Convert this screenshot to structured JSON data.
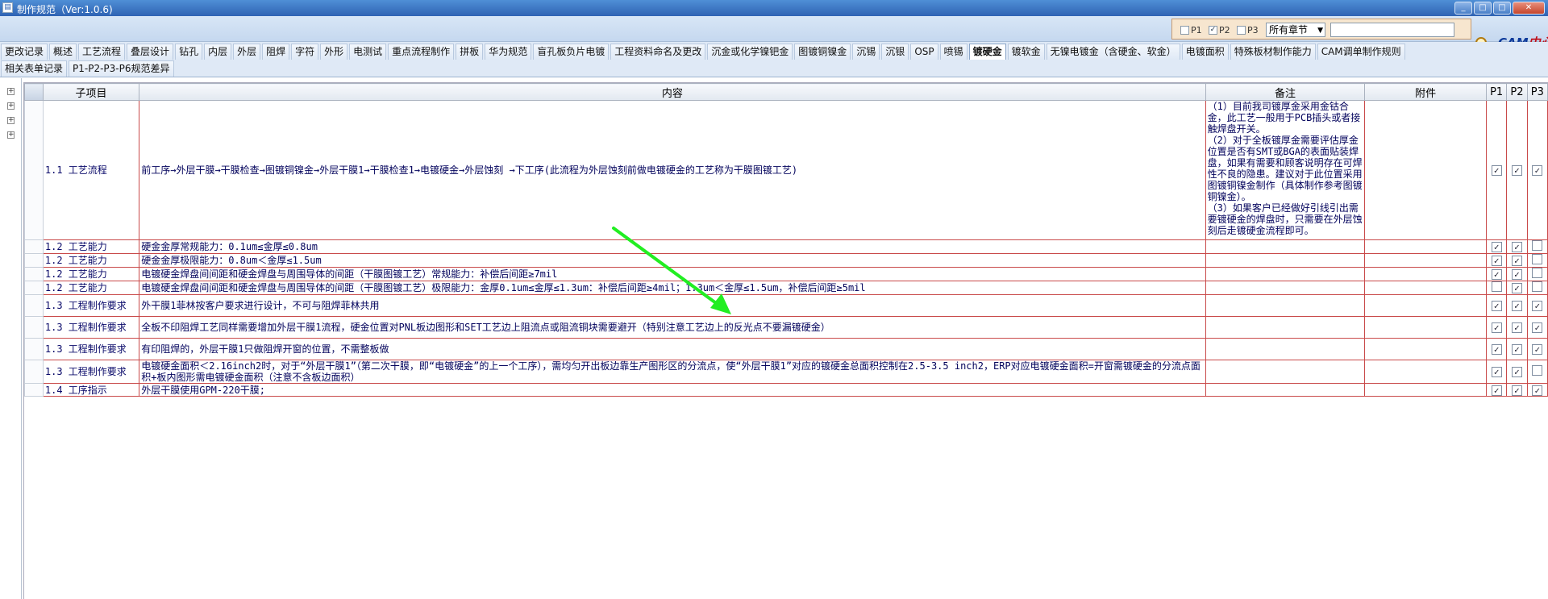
{
  "window": {
    "title": "制作规范（Ver:1.0.6)",
    "buttons": [
      "_",
      "□",
      "□",
      "✕"
    ]
  },
  "filter": {
    "p1": {
      "label": "P1",
      "checked": false
    },
    "p2": {
      "label": "P2",
      "checked": true
    },
    "p3": {
      "label": "P3",
      "checked": false
    },
    "chapter_select": "所有章节",
    "search_placeholder": ""
  },
  "logo": {
    "cam": "CAM",
    "rest": "中心"
  },
  "tabs_row1": [
    "更改记录",
    "概述",
    "工艺流程",
    "叠层设计",
    "钻孔",
    "内层",
    "外层",
    "阻焊",
    "字符",
    "外形",
    "电测试",
    "重点流程制作",
    "拼板",
    "华为规范",
    "盲孔板负片电镀",
    "工程资料命名及更改",
    "沉金或化学镍钯金",
    "图镀铜镍金",
    "沉锡",
    "沉银",
    "OSP",
    "喷锡",
    "镀硬金",
    "镀软金",
    "无镍电镀金（含硬金、软金）",
    "电镀面积",
    "特殊板材制作能力",
    "CAM调单制作规则"
  ],
  "tabs_row2": [
    "相关表单记录",
    "P1-P2-P3-P6规范差异"
  ],
  "active_tab": "镀硬金",
  "grid": {
    "headers": {
      "sub": "子项目",
      "content": "内容",
      "note": "备注",
      "attach": "附件",
      "p1": "P1",
      "p2": "P2",
      "p3": "P3"
    },
    "rows": [
      {
        "sub": "1.1 工艺流程",
        "content": "前工序→外层干膜→干膜检查→图镀铜镍金→外层干膜1→干膜检查1→电镀硬金→外层蚀刻 →下工序(此流程为外层蚀刻前做电镀硬金的工艺称为干膜图镀工艺)",
        "note": "（1）目前我司镀厚金采用金钴合金，此工艺一般用于PCB插头或者接触焊盘开关。\n（2）对于全板镀厚金需要评估厚金位置是否有SMT或BGA的表面贴装焊盘，如果有需要和顾客说明存在可焊性不良的隐患。建议对于此位置采用图镀铜镍金制作（具体制作参考图镀铜镍金）。\n（3）如果客户已经做好引线引出需要镀硬金的焊盘时，只需要在外层蚀刻后走镀硬金流程即可。",
        "attach": "",
        "p1": "✓",
        "p2": "✓",
        "p3": "✓"
      },
      {
        "sub": "1.2 工艺能力",
        "content": "硬金金厚常规能力：0.1um≤金厚≤0.8um",
        "note": "",
        "attach": "",
        "p1": "✓",
        "p2": "✓",
        "p3": ""
      },
      {
        "sub": "1.2 工艺能力",
        "content": "硬金金厚极限能力：0.8um＜金厚≤1.5um",
        "note": "",
        "attach": "",
        "p1": "✓",
        "p2": "✓",
        "p3": ""
      },
      {
        "sub": "1.2 工艺能力",
        "content": "电镀硬金焊盘间间距和硬金焊盘与周围导体的间距（干膜图镀工艺）常规能力：补偿后间距≥7mil",
        "note": "",
        "attach": "",
        "p1": "✓",
        "p2": "✓",
        "p3": ""
      },
      {
        "sub": "1.2 工艺能力",
        "content": "电镀硬金焊盘间间距和硬金焊盘与周围导体的间距（干膜图镀工艺）极限能力：金厚0.1um≤金厚≤1.3um：补偿后间距≥4mil；1.3um＜金厚≤1.5um，补偿后间距≥5mil",
        "note": "",
        "attach": "",
        "p1": "",
        "p2": "✓",
        "p3": ""
      },
      {
        "sub": "1.3 工程制作要求",
        "content": "外干膜1菲林按客户要求进行设计，不可与阻焊菲林共用",
        "note": "",
        "attach": "",
        "p1": "✓",
        "p2": "✓",
        "p3": "✓"
      },
      {
        "sub": "1.3 工程制作要求",
        "content": "全板不印阻焊工艺同样需要增加外层干膜1流程，硬金位置对PNL板边图形和SET工艺边上阻流点或阻流铜块需要避开（特别注意工艺边上的反光点不要漏镀硬金）",
        "note": "",
        "attach": "",
        "p1": "✓",
        "p2": "✓",
        "p3": "✓"
      },
      {
        "sub": "1.3 工程制作要求",
        "content": "有印阻焊的，外层干膜1只做阻焊开窗的位置，不需整板做",
        "note": "",
        "attach": "",
        "p1": "✓",
        "p2": "✓",
        "p3": "✓"
      },
      {
        "sub": "1.3 工程制作要求",
        "content": "电镀硬金面积＜2.16inch2时，对于“外层干膜1”（第二次干膜，即“电镀硬金”的上一个工序），需均匀开出板边靠生产图形区的分流点，使“外层干膜1”对应的镀硬金总面积控制在2.5-3.5 inch2，ERP对应电镀硬金面积=开窗需镀硬金的分流点面积+板内图形需电镀硬金面积（注意不含板边面积）",
        "note": "",
        "attach": "",
        "p1": "✓",
        "p2": "✓",
        "p3": ""
      },
      {
        "sub": "1.4 工序指示",
        "content": "外层干膜使用GPM-220干膜;",
        "note": "",
        "attach": "",
        "p1": "✓",
        "p2": "✓",
        "p3": "✓"
      }
    ]
  },
  "colors": {
    "grid_border": "#c94a4a",
    "text": "#03035c",
    "arrow": "#22ee22",
    "title_bar": "#2f63b3"
  }
}
